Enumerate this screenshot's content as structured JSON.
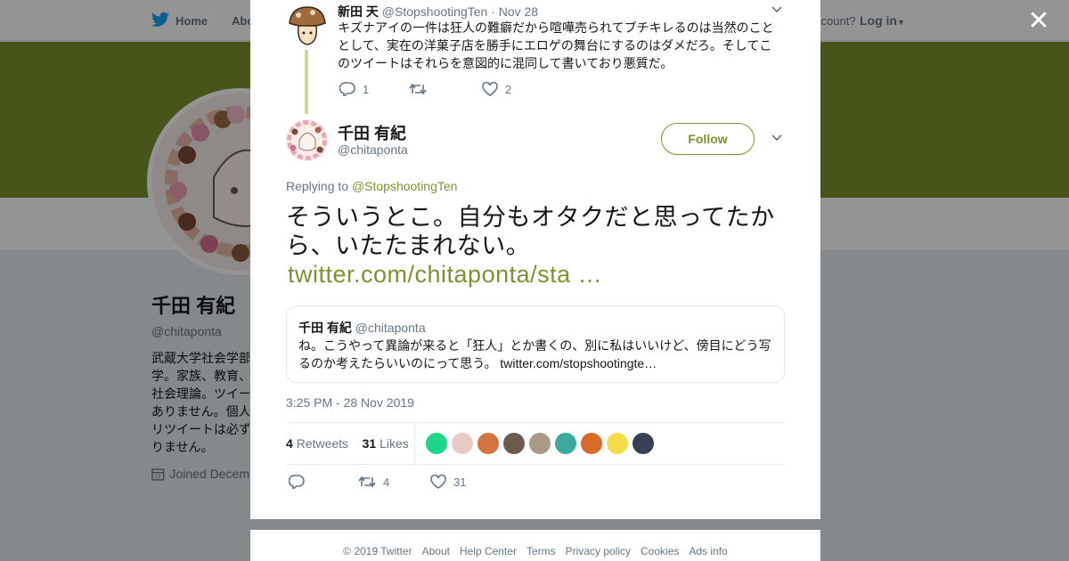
{
  "topbar": {
    "home": "Home",
    "about": "Abo",
    "account_prompt": "ccount?",
    "login": "Log in"
  },
  "profile": {
    "name": "千田 有紀",
    "handle": "@chitaponta",
    "bio": "武蔵大学社会学部\n学。家族、教育、\n社会理論。ツイー\nありません。個人\nリツイートは必ず\nりません。",
    "joined": "Joined Decem"
  },
  "parent_tweet": {
    "name": "新田 天",
    "handle": "@StopshootingTen",
    "date": "· Nov 28",
    "text": "キズナアイの一件は狂人の難癖だから喧嘩売られてブチキレるのは当然のこととして、実在の洋菓子店を勝手にエロゲの舞台にするのはダメだろ。そしてこのツイートはそれらを意図的に混同して書いており悪質だ。",
    "replies": "1",
    "retweets": "",
    "likes": "2"
  },
  "tweet": {
    "name": "千田 有紀",
    "handle": "@chitaponta",
    "follow_label": "Follow",
    "replying_prefix": "Replying to ",
    "replying_to": "@StopshootingTen",
    "text": "そういうとこ。自分もオタクだと思ってたから、いたたまれない。",
    "link": "twitter.com/chitaponta/sta …",
    "timestamp": "3:25 PM - 28 Nov 2019",
    "retweet_count": "4",
    "retweet_label": "Retweets",
    "like_count": "31",
    "like_label": "Likes",
    "action_replies": "",
    "action_retweets": "4",
    "action_likes": "31"
  },
  "quote": {
    "name": "千田 有紀",
    "handle": "@chitaponta",
    "text": "ね。こうやって異論が来ると「狂人」とか書くの、別に私はいいけど、傍目にどう写るのか考えたらいいのにって思う。 ",
    "link": "twitter.com/stopshootingte…"
  },
  "likers": [
    "#1dd68a",
    "#e9c9c4",
    "#d2743c",
    "#6b5a4e",
    "#a89a86",
    "#3aa89c",
    "#d96a2a",
    "#f2dc4a",
    "#3a3f58"
  ],
  "footer": [
    "© 2019 Twitter",
    "About",
    "Help Center",
    "Terms",
    "Privacy policy",
    "Cookies",
    "Ads info"
  ],
  "close_label": "✕",
  "colors": {
    "accent": "#7b9330",
    "banner": "#7b9330",
    "thread": "#cddc9a"
  }
}
